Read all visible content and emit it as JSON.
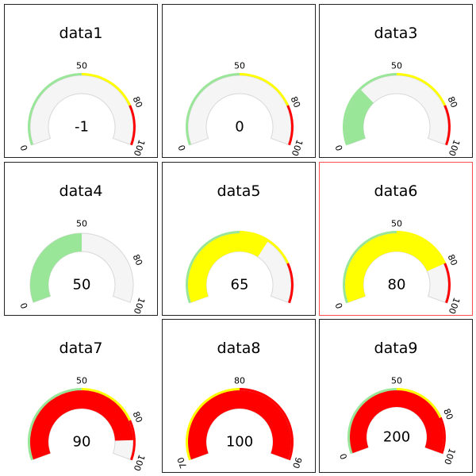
{
  "chart_data": [
    {
      "type": "gauge",
      "title": "data1",
      "value": -1,
      "display": "-1",
      "min": 0,
      "max": 100,
      "ticks": [
        "0",
        "50",
        "80",
        "100"
      ],
      "thresholds": [
        {
          "to": 50,
          "color": "#99e699"
        },
        {
          "to": 80,
          "color": "#ffff00"
        },
        {
          "to": 100,
          "color": "#ff0000"
        }
      ],
      "fill_color": null,
      "frame": "border"
    },
    {
      "type": "gauge",
      "title": "",
      "value": 0,
      "display": "0",
      "min": 0,
      "max": 100,
      "ticks": [
        "0",
        "50",
        "80",
        "100"
      ],
      "thresholds": [
        {
          "to": 50,
          "color": "#99e699"
        },
        {
          "to": 80,
          "color": "#ffff00"
        },
        {
          "to": 100,
          "color": "#ff0000"
        }
      ],
      "fill_color": null,
      "frame": "border"
    },
    {
      "type": "gauge",
      "title": "data3",
      "value": 30,
      "display": "",
      "min": 0,
      "max": 100,
      "ticks": [
        "0",
        "50",
        "80",
        "100"
      ],
      "thresholds": [
        {
          "to": 50,
          "color": "#99e699"
        },
        {
          "to": 80,
          "color": "#ffff00"
        },
        {
          "to": 100,
          "color": "#ff0000"
        }
      ],
      "fill_color": "#99e699",
      "frame": "border"
    },
    {
      "type": "gauge",
      "title": "data4",
      "value": 50,
      "display": "50",
      "min": 0,
      "max": 100,
      "ticks": [
        "0",
        "50",
        "80",
        "100"
      ],
      "thresholds": [],
      "fill_color": "#99e699",
      "frame": "border"
    },
    {
      "type": "gauge",
      "title": "data5",
      "value": 65,
      "display": "65",
      "min": 0,
      "max": 100,
      "ticks": [],
      "thresholds": [
        {
          "to": 50,
          "color": "#99e699"
        },
        {
          "to": 80,
          "color": "#ffff00"
        },
        {
          "to": 100,
          "color": "#ff0000"
        }
      ],
      "fill_color": "#ffff00",
      "frame": "border"
    },
    {
      "type": "gauge",
      "title": "data6",
      "value": 80,
      "display": "80",
      "min": 0,
      "max": 100,
      "ticks": [
        "0",
        "50",
        "80",
        "100"
      ],
      "thresholds": [
        {
          "to": 50,
          "color": "#99e699"
        },
        {
          "to": 80,
          "color": "#ffff00"
        },
        {
          "to": 100,
          "color": "#ff0000"
        }
      ],
      "fill_color": "#ffff00",
      "frame": "highlight"
    },
    {
      "type": "gauge",
      "title": "data7",
      "value": 90,
      "display": "90",
      "min": 0,
      "max": 100,
      "ticks": [
        "50",
        "80",
        "100"
      ],
      "thresholds": [
        {
          "to": 50,
          "color": "#99e699"
        },
        {
          "to": 80,
          "color": "#ffff00"
        },
        {
          "to": 100,
          "color": "#ff0000"
        }
      ],
      "fill_color": "#ff0000",
      "frame": "none"
    },
    {
      "type": "gauge",
      "title": "data8",
      "value": 100,
      "display": "100",
      "min": 70,
      "max": 90,
      "ticks": [
        "70",
        "80",
        "90"
      ],
      "thresholds": [
        {
          "to": 80,
          "color": "#ffff00"
        },
        {
          "to": 90,
          "color": "#ff0000"
        }
      ],
      "fill_color": "#ff0000",
      "frame": "border"
    },
    {
      "type": "gauge",
      "title": "data9",
      "value": 200,
      "display": "200",
      "min": 0,
      "max": 100,
      "ticks": [
        "0",
        "50",
        "80",
        "100"
      ],
      "thresholds": [
        {
          "to": 50,
          "color": "#99e699"
        },
        {
          "to": 80,
          "color": "#ffff00"
        },
        {
          "to": 100,
          "color": "#ff0000"
        }
      ],
      "fill_color": "#ff0000",
      "frame": "border",
      "compact": true
    }
  ]
}
